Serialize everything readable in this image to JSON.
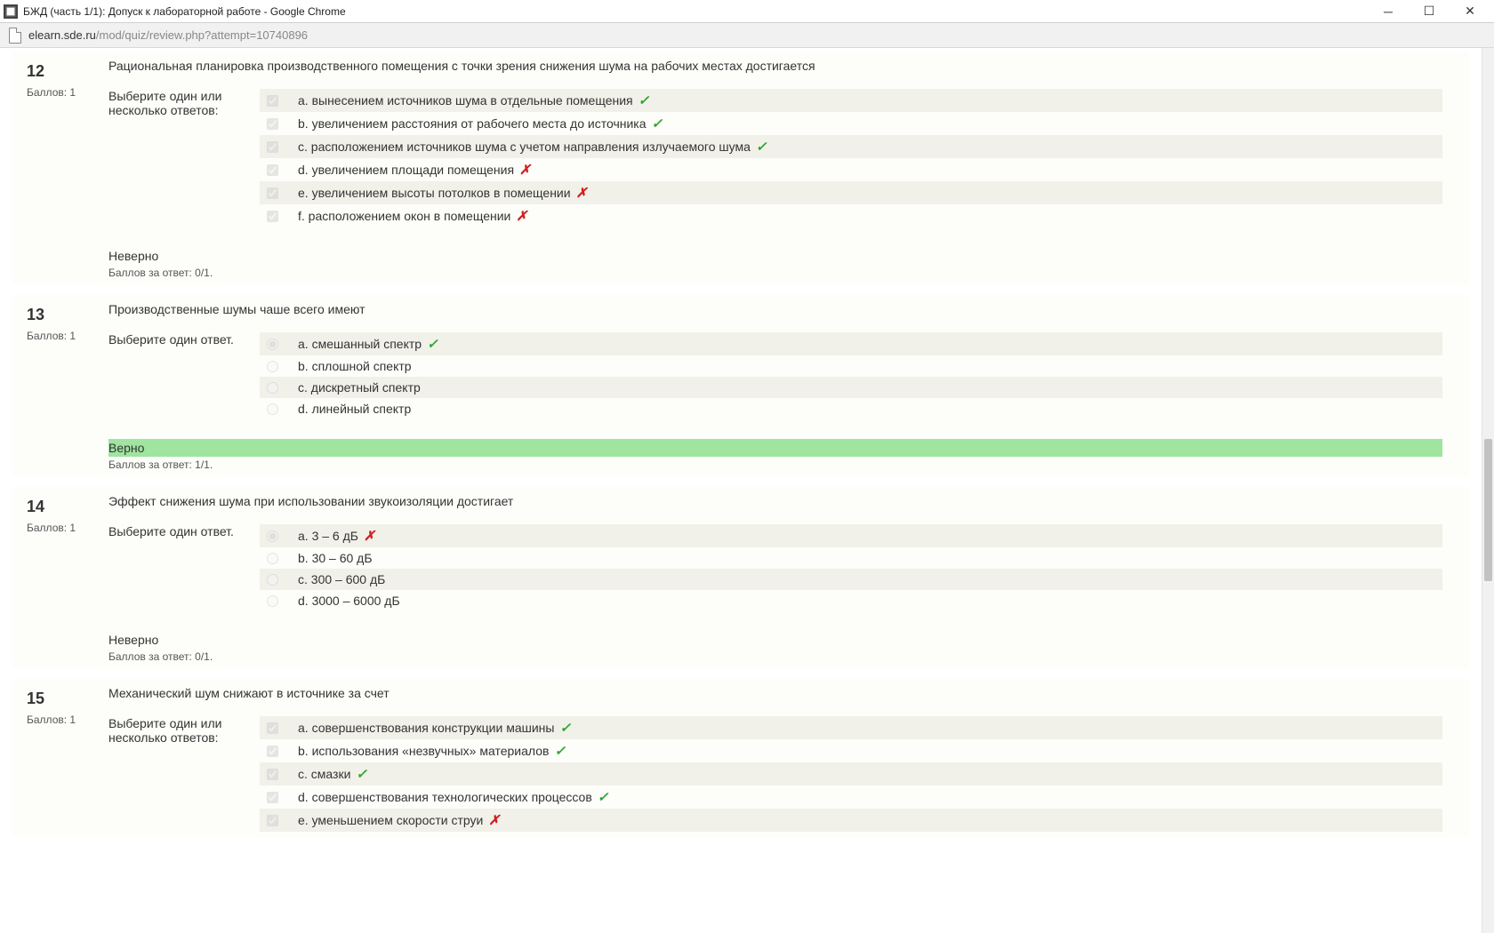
{
  "window": {
    "title": "БЖД (часть 1/1): Допуск к лабораторной работе - Google Chrome"
  },
  "address": {
    "host": "elearn.sde.ru",
    "path": "/mod/quiz/review.php?attempt=10740896"
  },
  "questions": [
    {
      "number": "12",
      "points_label": "Баллов: 1",
      "text": "Рациональная планировка производственного помещения с точки зрения снижения шума на рабочих местах достигается",
      "prompt": "Выберите один или несколько ответов:",
      "input_type": "checkbox",
      "options": [
        {
          "text": "a. вынесением источников шума в отдельные помещения",
          "checked": true,
          "mark": "ok"
        },
        {
          "text": "b. увеличением расстояния от рабочего места до источника",
          "checked": true,
          "mark": "ok"
        },
        {
          "text": "c. расположением источников шума с учетом направления излучаемого шума",
          "checked": true,
          "mark": "ok"
        },
        {
          "text": "d. увеличением площади помещения",
          "checked": true,
          "mark": "bad"
        },
        {
          "text": "e. увеличением высоты потолков в помещении",
          "checked": true,
          "mark": "bad"
        },
        {
          "text": "f. расположением окон в помещении",
          "checked": true,
          "mark": "bad"
        }
      ],
      "feedback": {
        "verdict": "Неверно",
        "correct": false,
        "score": "Баллов за ответ: 0/1."
      }
    },
    {
      "number": "13",
      "points_label": "Баллов: 1",
      "text": "Производственные шумы чаше всего имеют",
      "prompt": "Выберите один ответ.",
      "input_type": "radio",
      "options": [
        {
          "text": "a. смешанный спектр",
          "checked": true,
          "mark": "ok"
        },
        {
          "text": "b. сплошной спектр",
          "checked": false,
          "mark": ""
        },
        {
          "text": "c. дискретный спектр",
          "checked": false,
          "mark": ""
        },
        {
          "text": "d. линейный спектр",
          "checked": false,
          "mark": ""
        }
      ],
      "feedback": {
        "verdict": "Верно",
        "correct": true,
        "score": "Баллов за ответ: 1/1."
      }
    },
    {
      "number": "14",
      "points_label": "Баллов: 1",
      "text": "Эффект снижения шума при использовании звукоизоляции достигает",
      "prompt": "Выберите один ответ.",
      "input_type": "radio",
      "options": [
        {
          "text": "a. 3 – 6 дБ",
          "checked": true,
          "mark": "bad"
        },
        {
          "text": "b. 30 – 60 дБ",
          "checked": false,
          "mark": ""
        },
        {
          "text": "c. 300 – 600 дБ",
          "checked": false,
          "mark": ""
        },
        {
          "text": "d. 3000 – 6000 дБ",
          "checked": false,
          "mark": ""
        }
      ],
      "feedback": {
        "verdict": "Неверно",
        "correct": false,
        "score": "Баллов за ответ: 0/1."
      }
    },
    {
      "number": "15",
      "points_label": "Баллов: 1",
      "text": "Механический шум снижают в источнике за счет",
      "prompt": "Выберите один или несколько ответов:",
      "input_type": "checkbox",
      "options": [
        {
          "text": "a. совершенствования конструкции машины",
          "checked": true,
          "mark": "ok"
        },
        {
          "text": "b. использования «незвучных» материалов",
          "checked": true,
          "mark": "ok"
        },
        {
          "text": "c. смазки",
          "checked": true,
          "mark": "ok"
        },
        {
          "text": "d. совершенствования технологических процессов",
          "checked": true,
          "mark": "ok"
        },
        {
          "text": "e. уменьшением скорости струи",
          "checked": true,
          "mark": "bad"
        }
      ],
      "feedback": null
    }
  ]
}
